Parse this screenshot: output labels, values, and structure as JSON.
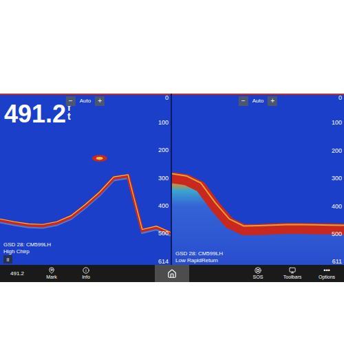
{
  "panels": [
    {
      "kind": "chirp",
      "depth": {
        "value": "491.2",
        "unit": "ft"
      },
      "zoom": {
        "minus": "−",
        "mode": "Auto",
        "plus": "+"
      },
      "scale": {
        "ticks": [
          "0",
          "100",
          "200",
          "300",
          "400",
          "500"
        ],
        "max": "614"
      },
      "source": "GSD 28: CM599LH",
      "channel": "High Chirp",
      "pause": "II",
      "bottom": [
        452,
        462,
        470,
        472,
        462,
        440,
        400,
        355,
        300,
        292,
        490,
        478,
        500
      ],
      "targets": [
        {
          "sample": 7,
          "depth": 229
        }
      ]
    },
    {
      "kind": "rapid",
      "zoom": {
        "minus": "−",
        "mode": "Auto",
        "plus": "+"
      },
      "scale": {
        "ticks": [
          "0",
          "100",
          "200",
          "300",
          "400",
          "500"
        ],
        "max": "611"
      },
      "source": "GSD 28: CM599LH",
      "channel": "Low RapidReturn",
      "bottom": [
        297,
        305,
        330,
        400,
        460,
        485,
        484,
        482,
        480,
        480,
        481,
        482,
        483
      ],
      "targets": []
    }
  ],
  "nav": [
    {
      "kind": "reading",
      "label": "491.2"
    },
    {
      "kind": "button",
      "label": "Mark"
    },
    {
      "kind": "button",
      "label": "Info"
    },
    {
      "kind": "home"
    },
    {
      "kind": "button",
      "label": "SOS"
    },
    {
      "kind": "button",
      "label": "Toolbars"
    },
    {
      "kind": "button",
      "label": "Options",
      "glyph": "•••"
    }
  ]
}
